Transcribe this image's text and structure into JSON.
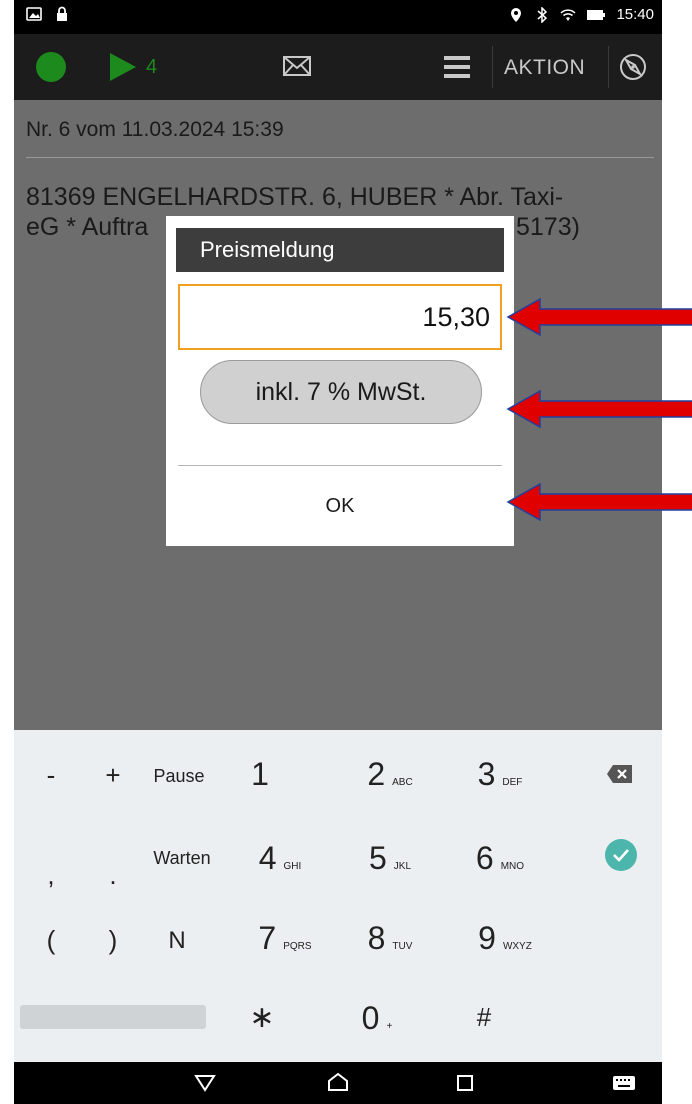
{
  "status_bar": {
    "time": "15:40"
  },
  "action_bar": {
    "order_count": "4",
    "action_label": "AKTION"
  },
  "order": {
    "header": "Nr. 6 vom 11.03.2024 15:39",
    "address_line1": "81369 ENGELHARDSTR. 6, HUBER * Abr. Taxi-",
    "address_line2_left": "eG * Auftra",
    "address_line2_right": "5173)"
  },
  "dialog": {
    "title": "Preismeldung",
    "price_value": "15,30",
    "vat_label": "inkl. 7 % MwSt.",
    "ok_label": "OK"
  },
  "keyboard": {
    "row1": {
      "minus": "-",
      "plus": "+",
      "pause": "Pause",
      "k1": "1",
      "k2": "2",
      "k2_sub": "ABC",
      "k3": "3",
      "k3_sub": "DEF"
    },
    "row2": {
      "comma": ",",
      "dot": ".",
      "wait": "Warten",
      "k4": "4",
      "k4_sub": "GHI",
      "k5": "5",
      "k5_sub": "JKL",
      "k6": "6",
      "k6_sub": "MNO"
    },
    "row3": {
      "paren_open": "(",
      "paren_close": ")",
      "n": "N",
      "k7": "7",
      "k7_sub": "PQRS",
      "k8": "8",
      "k8_sub": "TUV",
      "k9": "9",
      "k9_sub": "WXYZ"
    },
    "row4": {
      "star": "∗",
      "k0": "0",
      "k0_sub": "+",
      "hash": "#"
    }
  },
  "colors": {
    "accent_green": "#1c8a1c",
    "field_border": "#f0a020",
    "done_teal": "#4db6ac",
    "arrow_red": "#e00000"
  }
}
